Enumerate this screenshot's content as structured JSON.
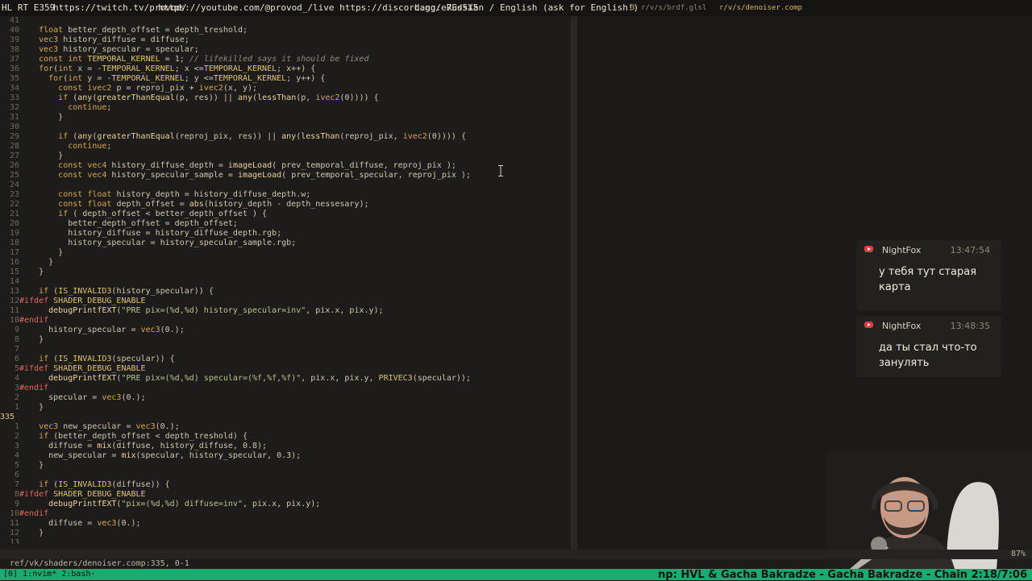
{
  "topbar": {
    "workspace": "HL RT E359",
    "twitch_url": "https://twitch.tv/provod/",
    "stream_links": "https://youtube.com/@provod_/live https://discord.gg/e7Ed5X5",
    "lang": "Lang: Russian / English (ask for English!)",
    "tab_brdf_num": "3",
    "tab_brdf": "r/v/s/brdf.glsl",
    "tab_denoiser": "r/v/s/denoiser.comp",
    "tray": "",
    "clock": ""
  },
  "editor": {
    "lines": [
      {
        "num": "41",
        "text": ""
      },
      {
        "num": "40",
        "text": "    float better_depth_offset = depth_treshold;"
      },
      {
        "num": "39",
        "text": "    vec3 history_diffuse = diffuse;"
      },
      {
        "num": "38",
        "text": "    vec3 history_specular = specular;"
      },
      {
        "num": "37",
        "text": "    const int TEMPORAL_KERNEL = 1; // lifekilled says it should be fixed"
      },
      {
        "num": "36",
        "text": "    for(int x = -TEMPORAL_KERNEL; x <=TEMPORAL_KERNEL; x++) {"
      },
      {
        "num": "35",
        "text": "      for(int y = -TEMPORAL_KERNEL; y <=TEMPORAL_KERNEL; y++) {"
      },
      {
        "num": "34",
        "text": "        const ivec2 p = reproj_pix + ivec2(x, y);"
      },
      {
        "num": "33",
        "text": "        if (any(greaterThanEqual(p, res)) || any(lessThan(p, ivec2(0)))) {"
      },
      {
        "num": "32",
        "text": "          continue;"
      },
      {
        "num": "31",
        "text": "        }"
      },
      {
        "num": "30",
        "text": ""
      },
      {
        "num": "29",
        "text": "        if (any(greaterThanEqual(reproj_pix, res)) || any(lessThan(reproj_pix, ivec2(0)))) {"
      },
      {
        "num": "28",
        "text": "          continue;"
      },
      {
        "num": "27",
        "text": "        }"
      },
      {
        "num": "26",
        "text": "        const vec4 history_diffuse_depth = imageLoad( prev_temporal_diffuse, reproj_pix );"
      },
      {
        "num": "25",
        "text": "        const vec4 history_specular_sample = imageLoad( prev_temporal_specular, reproj_pix );"
      },
      {
        "num": "24",
        "text": ""
      },
      {
        "num": "23",
        "text": "        const float history_depth = history_diffuse_depth.w;"
      },
      {
        "num": "22",
        "text": "        const float depth_offset = abs(history_depth - depth_nessesary);"
      },
      {
        "num": "21",
        "text": "        if ( depth_offset < better_depth_offset ) {"
      },
      {
        "num": "20",
        "text": "          better_depth_offset = depth_offset;"
      },
      {
        "num": "19",
        "text": "          history_diffuse = history_diffuse_depth.rgb;"
      },
      {
        "num": "18",
        "text": "          history_specular = history_specular_sample.rgb;"
      },
      {
        "num": "17",
        "text": "        }"
      },
      {
        "num": "16",
        "text": "      }"
      },
      {
        "num": "15",
        "text": "    }"
      },
      {
        "num": "14",
        "text": ""
      },
      {
        "num": "13",
        "text": "    if (IS_INVALID3(history_specular)) {"
      },
      {
        "num": "12",
        "text": "#ifdef SHADER_DEBUG_ENABLE"
      },
      {
        "num": "11",
        "text": "      debugPrintfEXT(\"PRE pix=(%d,%d) history_specular=inv\", pix.x, pix.y);"
      },
      {
        "num": "10",
        "text": "#endif"
      },
      {
        "num": "9",
        "text": "      history_specular = vec3(0.);"
      },
      {
        "num": "8",
        "text": "    }"
      },
      {
        "num": "7",
        "text": ""
      },
      {
        "num": "6",
        "text": "    if (IS_INVALID3(specular)) {"
      },
      {
        "num": "5",
        "text": "#ifdef SHADER_DEBUG_ENABLE"
      },
      {
        "num": "4",
        "text": "      debugPrintfEXT(\"PRE pix=(%d,%d) specular=(%f,%f,%f)\", pix.x, pix.y, PRIVEC3(specular));"
      },
      {
        "num": "3",
        "text": "#endif"
      },
      {
        "num": "2",
        "text": "      specular = vec3(0.);"
      },
      {
        "num": "1",
        "text": "    }"
      },
      {
        "num": "335",
        "text": ""
      },
      {
        "num": "1",
        "text": "    vec3 new_specular = vec3(0.);"
      },
      {
        "num": "2",
        "text": "    if (better_depth_offset < depth_treshold) {"
      },
      {
        "num": "3",
        "text": "      diffuse = mix(diffuse, history_diffuse, 0.8);"
      },
      {
        "num": "4",
        "text": "      new_specular = mix(specular, history_specular, 0.3);"
      },
      {
        "num": "5",
        "text": "    }"
      },
      {
        "num": "6",
        "text": ""
      },
      {
        "num": "7",
        "text": "    if (IS_INVALID3(diffuse)) {"
      },
      {
        "num": "8",
        "text": "#ifdef SHADER_DEBUG_ENABLE"
      },
      {
        "num": "9",
        "text": "      debugPrintfEXT(\"pix=(%d,%d) diffuse=inv\", pix.x, pix.y);"
      },
      {
        "num": "10",
        "text": "#endif"
      },
      {
        "num": "11",
        "text": "      diffuse = vec3(0.);"
      },
      {
        "num": "12",
        "text": "    }"
      },
      {
        "num": "13",
        "text": ""
      }
    ]
  },
  "statusline": {
    "file": "ref/vk/shaders/denoiser.comp:335, 0-1",
    "percent": "87%"
  },
  "tmux": {
    "tabs": "[0] 1:nvim* 2:bash-",
    "now_playing": "np: HVL & Gacha Bakradze - Gacha Bakradze - Chain 2:18/7:06"
  },
  "chat": [
    {
      "user": "NightFox",
      "time": "13:47:54",
      "message": "у тебя тут старая карта"
    },
    {
      "user": "NightFox",
      "time": "13:48:35",
      "message": "да ты стал что-то занулять"
    }
  ],
  "colors": {
    "background": "#1d1c1a",
    "keyword": "#d8a84a",
    "type": "#e0c46b",
    "function": "#ecd39a",
    "comment": "#8f8a7c",
    "string": "#b7c48a",
    "macro": "#e06a55",
    "tmux_green": "#19ab6f",
    "youtube_red": "#e33b3b"
  },
  "icons": [
    "youtube-icon",
    "text-cursor-icon"
  ]
}
